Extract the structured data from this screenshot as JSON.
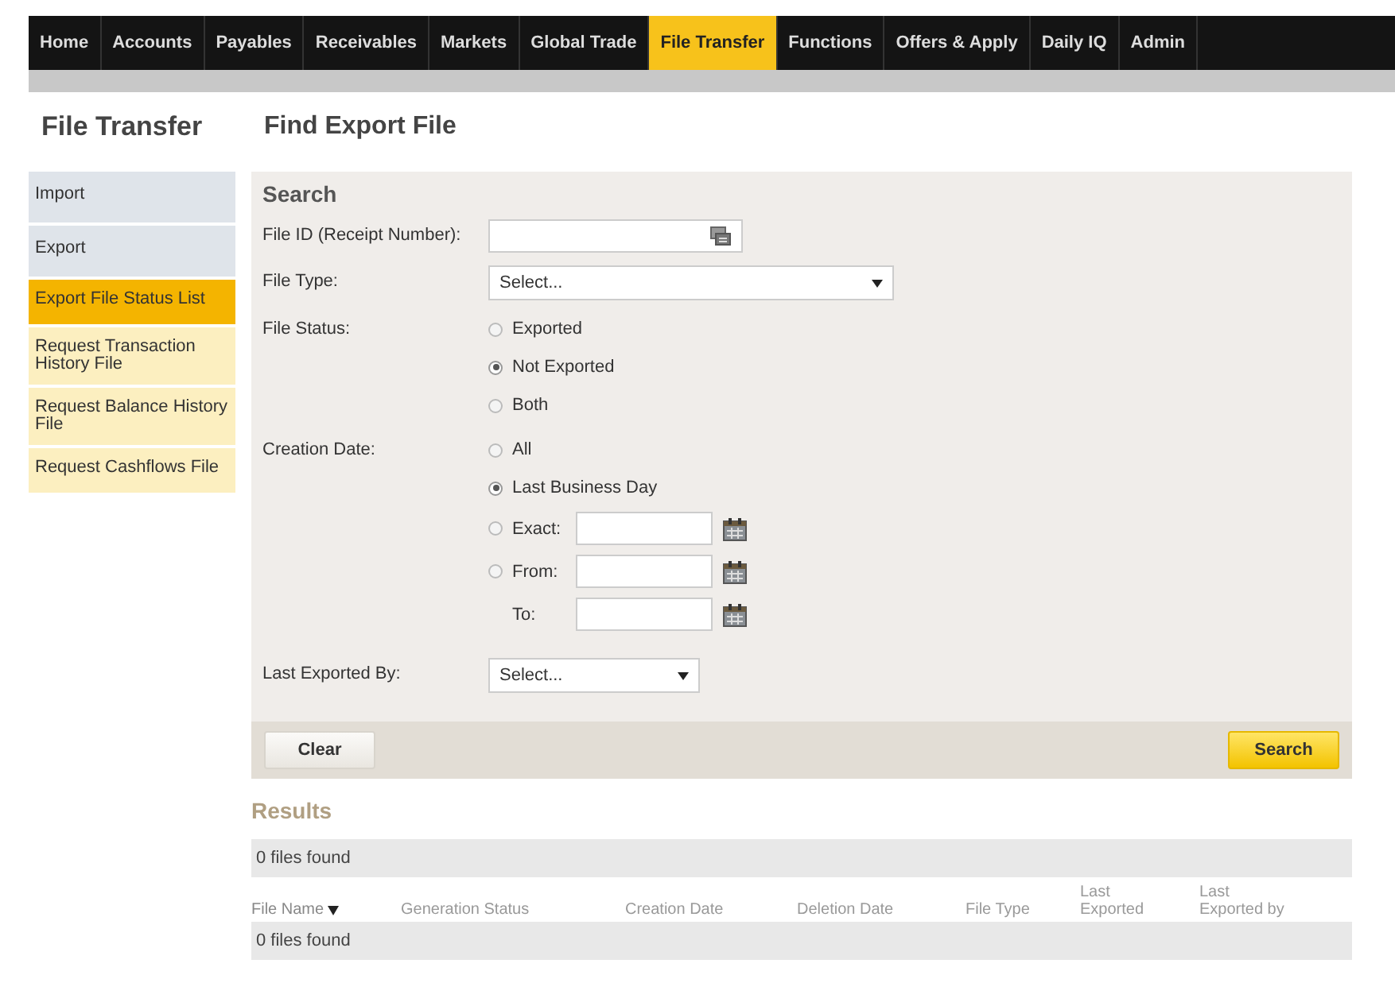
{
  "nav": [
    {
      "label": "Home",
      "selected": false
    },
    {
      "label": "Accounts",
      "selected": false
    },
    {
      "label": "Payables",
      "selected": false
    },
    {
      "label": "Receivables",
      "selected": false
    },
    {
      "label": "Markets",
      "selected": false
    },
    {
      "label": "Global Trade",
      "selected": false
    },
    {
      "label": "File Transfer",
      "selected": true
    },
    {
      "label": "Functions",
      "selected": false
    },
    {
      "label": "Offers & Apply",
      "selected": false
    },
    {
      "label": "Daily IQ",
      "selected": false
    },
    {
      "label": "Admin",
      "selected": false
    }
  ],
  "section_title": "File Transfer",
  "heading": "Find Export File",
  "sidebar": {
    "items": [
      {
        "label": "Import",
        "selected": false,
        "kind": "plain"
      },
      {
        "label": "Export",
        "selected": false,
        "kind": "plain"
      },
      {
        "label": "Export File Status List",
        "selected": true,
        "kind": "request"
      },
      {
        "label": "Request Transaction History File",
        "selected": false,
        "kind": "request"
      },
      {
        "label": "Request Balance History File",
        "selected": false,
        "kind": "request"
      },
      {
        "label": "Request Cashflows File",
        "selected": false,
        "kind": "request"
      }
    ]
  },
  "search": {
    "title": "Search",
    "fields": [
      {
        "kind": "text",
        "label": "File ID (Receipt Number):"
      },
      {
        "kind": "select-wide",
        "label": "File Type:",
        "value": "Select..."
      },
      {
        "kind": "radios",
        "label": "File Status:",
        "options": [
          {
            "kind": "radio",
            "label": "Exported",
            "selected": false
          },
          {
            "kind": "radio",
            "label": "Not Exported",
            "selected": true
          },
          {
            "kind": "radio",
            "label": "Both",
            "selected": false
          }
        ]
      },
      {
        "kind": "radios",
        "label": "Creation Date:",
        "options": [
          {
            "kind": "radio",
            "label": "All",
            "selected": false
          },
          {
            "kind": "radio",
            "label": "Last Business Day",
            "selected": true
          },
          {
            "kind": "radio-date",
            "label": "Exact:",
            "selected": false
          },
          {
            "kind": "radio-date",
            "label": "From:",
            "selected": false
          },
          {
            "kind": "date",
            "label": "To:"
          }
        ]
      },
      {
        "kind": "select",
        "label": "Last Exported By:",
        "value": "Select..."
      }
    ],
    "buttons": [
      {
        "kind": "plain",
        "label": "Clear"
      },
      {
        "kind": "primary",
        "label": "Search"
      }
    ]
  },
  "results": {
    "title": "Results",
    "summary": "0 files found",
    "columns": [
      {
        "label": "File Name",
        "sorted": true
      },
      {
        "label": "Generation Status",
        "sorted": false
      },
      {
        "label": "Creation Date",
        "sorted": false
      },
      {
        "label": "Deletion Date",
        "sorted": false
      },
      {
        "label": "File Type",
        "sorted": false
      },
      {
        "label": "Last Exported",
        "sorted": false
      },
      {
        "label": "Last Exported by",
        "sorted": false
      }
    ],
    "empty": "0 files found"
  }
}
